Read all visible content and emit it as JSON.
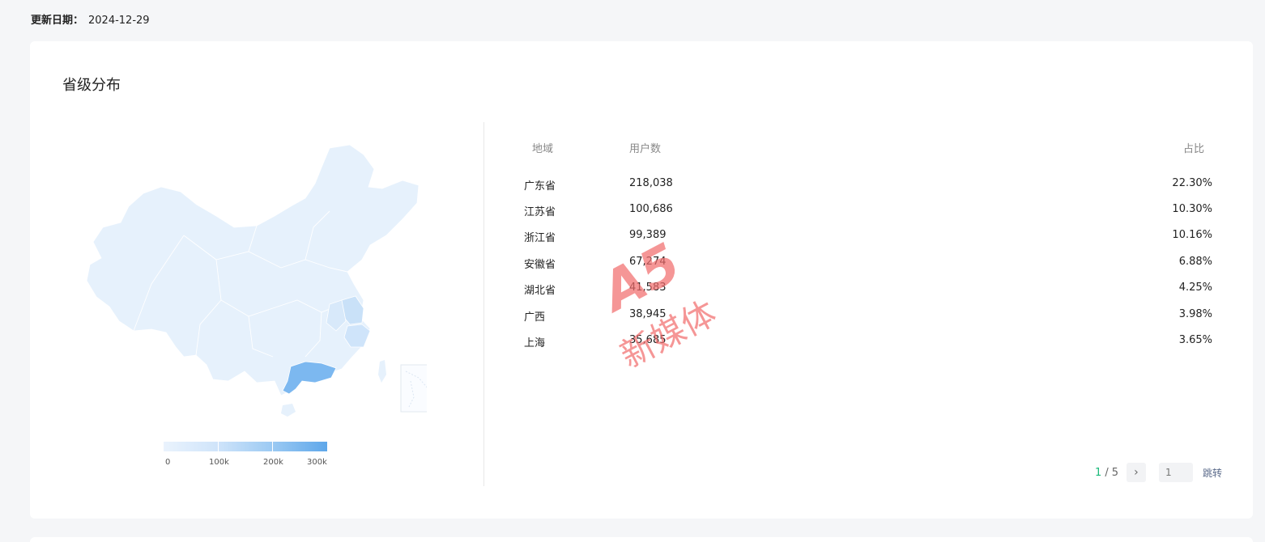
{
  "update": {
    "label": "更新日期：",
    "date": "2024-12-29"
  },
  "section": {
    "title": "省级分布"
  },
  "legend": {
    "ticks": [
      "0",
      "100k",
      "200k",
      "300k"
    ],
    "colors": [
      "#eaf3fd",
      "#cfe4fa",
      "#9ccaf3",
      "#5ea7ea"
    ]
  },
  "table": {
    "headers": {
      "region": "地域",
      "users": "用户数",
      "ratio": "占比"
    },
    "rows": [
      {
        "region": "广东省",
        "users": "218,038",
        "ratio": "22.30%"
      },
      {
        "region": "江苏省",
        "users": "100,686",
        "ratio": "10.30%"
      },
      {
        "region": "浙江省",
        "users": "99,389",
        "ratio": "10.16%"
      },
      {
        "region": "安徽省",
        "users": "67,274",
        "ratio": "6.88%"
      },
      {
        "region": "湖北省",
        "users": "41,583",
        "ratio": "4.25%"
      },
      {
        "region": "广西",
        "users": "38,945",
        "ratio": "3.98%"
      },
      {
        "region": "上海",
        "users": "35,685",
        "ratio": "3.65%"
      }
    ]
  },
  "pager": {
    "current": "1",
    "separator": "/",
    "total": "5",
    "input_placeholder": "1",
    "jump_label": "跳转",
    "next_icon": "chevron-right-icon"
  },
  "watermark": {
    "brand": "A5",
    "text": "新媒体"
  },
  "colors": {
    "accent_green": "#1ab97a",
    "map_highlight": "#7cb8f0",
    "map_base": "#e6f1fc"
  }
}
